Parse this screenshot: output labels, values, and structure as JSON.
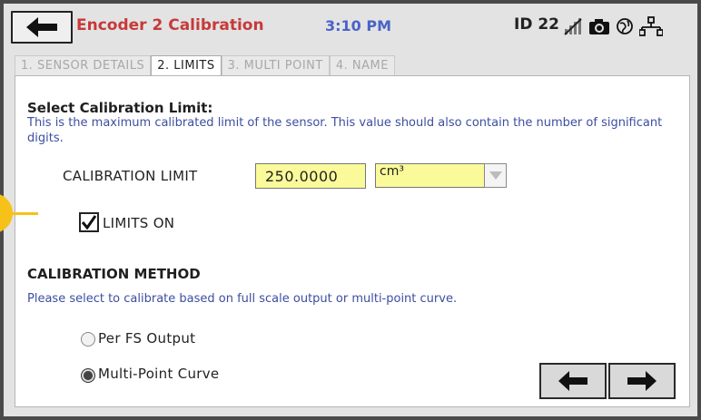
{
  "header": {
    "title": "Encoder 2 Calibration",
    "time": "3:10 PM",
    "device_id": "ID 22",
    "icons": [
      "back-arrow-icon",
      "no-signal-icon",
      "camera-icon",
      "globe-icon",
      "network-icon"
    ]
  },
  "tabs": [
    {
      "label": "1. SENSOR DETAILS",
      "active": false
    },
    {
      "label": "2. LIMITS",
      "active": true
    },
    {
      "label": "3. MULTI POINT",
      "active": false
    },
    {
      "label": "4. NAME",
      "active": false
    }
  ],
  "limits": {
    "heading": "Select Calibration Limit:",
    "description": "This is the maximum calibrated limit of the sensor.  This value should also contain the number of significant digits.",
    "limit_label": "CALIBRATION LIMIT",
    "limit_value": "250.0000",
    "unit_value": "cm³",
    "limits_on_label": "LIMITS ON",
    "limits_on_checked": true
  },
  "method": {
    "heading": "CALIBRATION METHOD",
    "description": "Please select to calibrate based on full scale output or multi-point curve.",
    "options": [
      {
        "label": "Per FS Output",
        "selected": false
      },
      {
        "label": "Multi-Point Curve",
        "selected": true
      }
    ]
  },
  "navigation": {
    "prev_icon": "left-arrow-icon",
    "next_icon": "right-arrow-icon"
  },
  "colors": {
    "title": "#c63a3a",
    "time": "#4a63c7",
    "description": "#3c4ea0",
    "input_highlight": "#fafa9a",
    "marker": "#f6c21a"
  }
}
